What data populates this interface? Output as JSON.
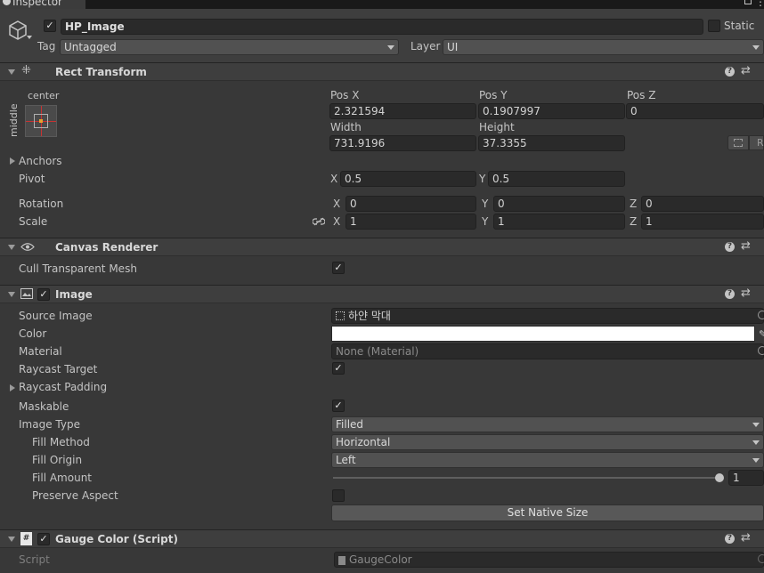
{
  "tab": {
    "label": "Inspector"
  },
  "object": {
    "active": "✓",
    "name": "HP_Image",
    "static_label": "Static",
    "tag_label": "Tag",
    "tag_value": "Untagged",
    "layer_label": "Layer",
    "layer_value": "UI"
  },
  "rect_transform": {
    "title": "Rect Transform",
    "anchor_h": "center",
    "anchor_v": "middle",
    "pos_x_label": "Pos X",
    "pos_x": "2.321594",
    "pos_y_label": "Pos Y",
    "pos_y": "0.1907997",
    "pos_z_label": "Pos Z",
    "pos_z": "0",
    "width_label": "Width",
    "width": "731.9196",
    "height_label": "Height",
    "height": "37.3355",
    "raw_button": "R",
    "anchors_label": "Anchors",
    "pivot_label": "Pivot",
    "pivot_x_axis": "X",
    "pivot_x": "0.5",
    "pivot_y_axis": "Y",
    "pivot_y": "0.5",
    "rotation_label": "Rotation",
    "rotation_x": "0",
    "rotation_y": "0",
    "rotation_z": "0",
    "scale_label": "Scale",
    "scale_x": "1",
    "scale_y": "1",
    "scale_z": "1",
    "axis_x": "X",
    "axis_y": "Y",
    "axis_z": "Z"
  },
  "canvas_renderer": {
    "title": "Canvas Renderer",
    "cull_label": "Cull Transparent Mesh",
    "cull_checked": "✓"
  },
  "image": {
    "title": "Image",
    "enabled": "✓",
    "source_label": "Source Image",
    "source_value": "하얀 막대",
    "color_label": "Color",
    "color_value": "#ffffff",
    "material_label": "Material",
    "material_value": "None (Material)",
    "raycast_target_label": "Raycast Target",
    "raycast_target_checked": "✓",
    "raycast_padding_label": "Raycast Padding",
    "maskable_label": "Maskable",
    "maskable_checked": "✓",
    "image_type_label": "Image Type",
    "image_type_value": "Filled",
    "fill_method_label": "Fill Method",
    "fill_method_value": "Horizontal",
    "fill_origin_label": "Fill Origin",
    "fill_origin_value": "Left",
    "fill_amount_label": "Fill Amount",
    "fill_amount_value": "1",
    "preserve_aspect_label": "Preserve Aspect",
    "native_size_button": "Set Native Size"
  },
  "gauge_color": {
    "title": "Gauge Color (Script)",
    "enabled": "✓",
    "script_label": "Script",
    "script_value": "GaugeColor"
  },
  "icons": {
    "header_help": "help-icon",
    "header_settings": "settings-sliders-icon"
  }
}
